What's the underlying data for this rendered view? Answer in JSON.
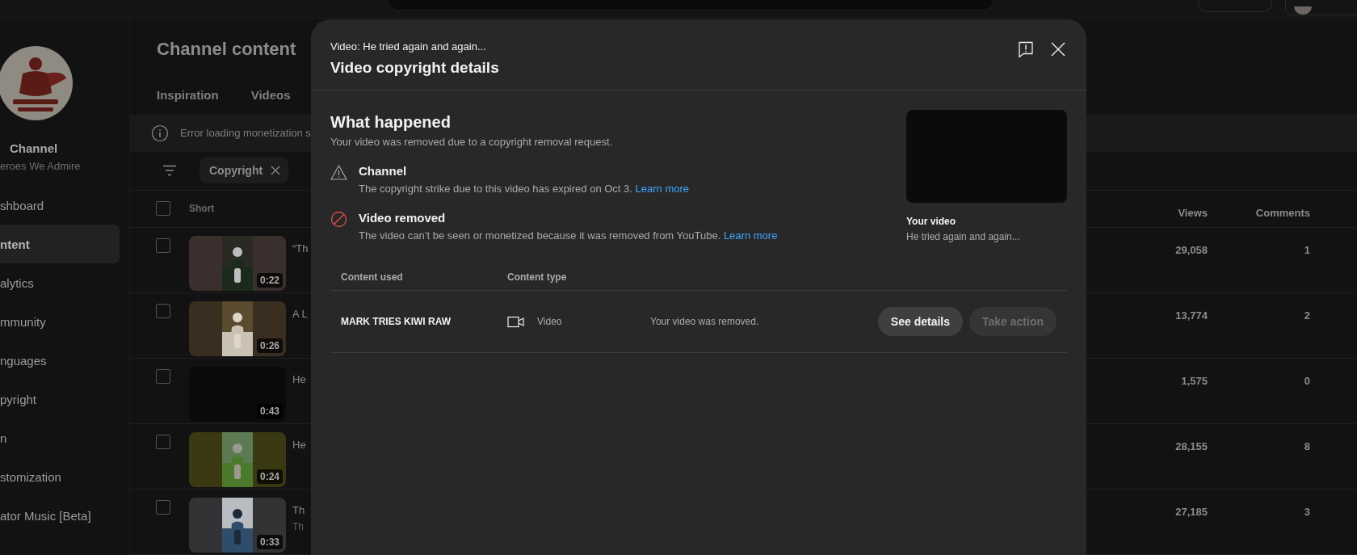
{
  "sidebar": {
    "channel_title": "Channel",
    "channel_name": "eroes We Admire",
    "items": [
      {
        "label": "shboard",
        "selected": false
      },
      {
        "label": "ntent",
        "selected": true
      },
      {
        "label": "alytics",
        "selected": false
      },
      {
        "label": "mmunity",
        "selected": false
      },
      {
        "label": "nguages",
        "selected": false
      },
      {
        "label": "pyright",
        "selected": false
      },
      {
        "label": "n",
        "selected": false
      },
      {
        "label": "stomization",
        "selected": false
      },
      {
        "label": "ator Music [Beta]",
        "selected": false
      }
    ]
  },
  "page": {
    "title": "Channel content",
    "tabs": [
      {
        "label": "Inspiration",
        "selected": false
      },
      {
        "label": "Videos",
        "selected": false
      }
    ],
    "banner": "Error loading monetization s",
    "filters": [
      {
        "label": "Copyright"
      }
    ]
  },
  "table": {
    "select_all": {
      "checked": false
    },
    "columns": [
      "Short",
      "Views",
      "Comments"
    ],
    "rows": [
      {
        "checked": false,
        "duration": "0:22",
        "title": "“Th",
        "views": "29,058",
        "comments": "1"
      },
      {
        "checked": false,
        "duration": "0:26",
        "title": "A L",
        "views": "13,774",
        "comments": "2"
      },
      {
        "checked": false,
        "duration": "0:43",
        "title": "He",
        "views": "1,575",
        "comments": "0"
      },
      {
        "checked": false,
        "duration": "0:24",
        "title": "He",
        "views": "28,155",
        "comments": "8"
      },
      {
        "checked": false,
        "duration": "0:33",
        "title": "Th",
        "subtitle": "Th",
        "views": "27,185",
        "comments": "3"
      }
    ]
  },
  "modal": {
    "video_label": "Video: He tried again and again...",
    "title": "Video copyright details",
    "section_title": "What happened",
    "summary": "Your video was removed due to a copyright removal request.",
    "notices": [
      {
        "kind": "warning",
        "title": "Channel",
        "text": "The copyright strike due to this video has expired on Oct 3.",
        "link": "Learn more"
      },
      {
        "kind": "removed",
        "title": "Video removed",
        "text": "The video can’t be seen or monetized because it was removed from YouTube.",
        "link": "Learn more"
      }
    ],
    "preview": {
      "label": "Your video",
      "title": "He tried again and again..."
    },
    "claims": {
      "columns": [
        "Content used",
        "Content type"
      ],
      "rows": [
        {
          "content": "MARK TRIES KIWI RAW",
          "type": "Video",
          "status": "Your video was removed.",
          "actions": [
            {
              "label": "See details",
              "disabled": false
            },
            {
              "label": "Take action",
              "disabled": true
            }
          ]
        }
      ]
    }
  }
}
